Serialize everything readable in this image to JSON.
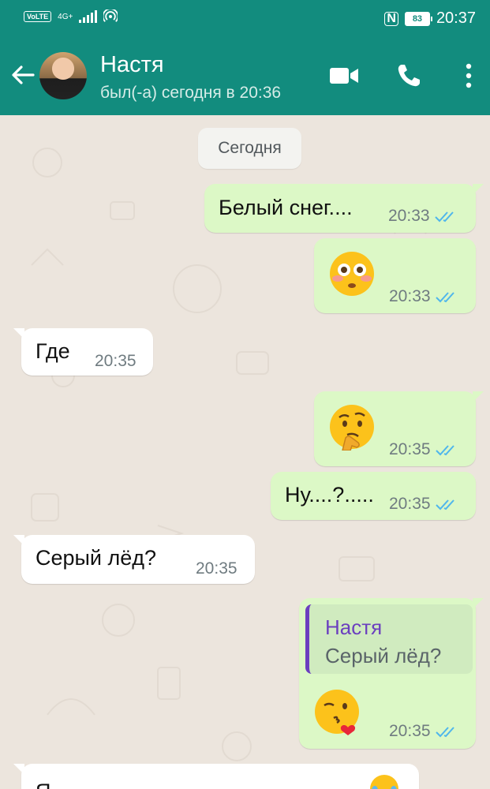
{
  "status_bar": {
    "volte": "VoLTE",
    "network": "4G+",
    "nfc": "N",
    "battery": "83",
    "time": "20:37"
  },
  "header": {
    "contact_name": "Настя",
    "last_seen": "был(-а) сегодня в 20:36",
    "icons": [
      "back-arrow-icon",
      "video-call-icon",
      "phone-call-icon",
      "more-options-icon"
    ]
  },
  "chat": {
    "date_chip": "Сегодня",
    "messages": [
      {
        "direction": "out",
        "text": "Белый снег....",
        "time": "20:33",
        "read": true
      },
      {
        "direction": "out",
        "emoji": "flushed-face",
        "time": "20:33",
        "read": true
      },
      {
        "direction": "in",
        "text": "Где",
        "time": "20:35"
      },
      {
        "direction": "out",
        "emoji": "thinking-face",
        "time": "20:35",
        "read": true
      },
      {
        "direction": "out",
        "text": "Ну....?.....",
        "time": "20:35",
        "read": true
      },
      {
        "direction": "in",
        "text": "Серый лёд?",
        "time": "20:35"
      },
      {
        "direction": "out",
        "reply_to": {
          "name": "Настя",
          "text": "Серый лёд?"
        },
        "emoji": "face-blowing-kiss",
        "time": "20:35",
        "read": true
      },
      {
        "direction": "in",
        "text": "Я",
        "partial": true
      }
    ]
  },
  "colors": {
    "header": "#128c7e",
    "outgoing_bubble": "#dcf8c6",
    "incoming_bubble": "#ffffff",
    "chat_background": "#ece5dd",
    "read_ticks": "#4fb6ec",
    "reply_accent": "#6b3fbf"
  }
}
